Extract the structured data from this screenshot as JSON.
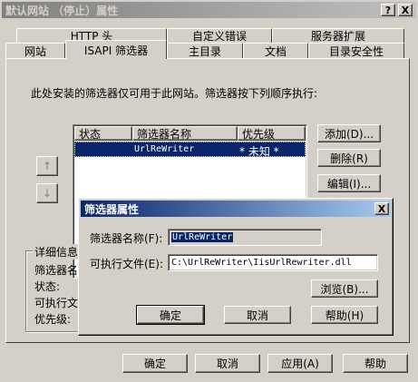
{
  "window": {
    "title": "默认网站 （停止）属性",
    "help_btn": "?",
    "close_btn": "X"
  },
  "tabs_row1": [
    "HTTP 头",
    "自定义错误",
    "服务器扩展"
  ],
  "tabs_row2": [
    "网站",
    "ISAPI 筛选器",
    "主目录",
    "文档",
    "目录安全性"
  ],
  "active_tab": "ISAPI 筛选器",
  "panel": {
    "description": "此处安装的筛选器仅可用于此网站。筛选器按下列顺序执行:",
    "columns": [
      "状态",
      "筛选器名称",
      "优先级"
    ],
    "rows": [
      {
        "status": "",
        "name": "UrlReWriter",
        "priority": "* 未知 *"
      }
    ],
    "buttons": {
      "add": "添加(D)...",
      "remove": "删除(R)",
      "edit": "编辑(I)..."
    },
    "move_up": "↑",
    "move_down": "↓",
    "details": {
      "title": "详细信息",
      "name_label": "筛选器名",
      "status_label": "状态:",
      "exe_label": "可执行文",
      "priority_label": "优先级:"
    }
  },
  "dialog": {
    "title": "筛选器属性",
    "close_btn": "X",
    "name_label": "筛选器名称(F):",
    "name_value": "UrlReWriter",
    "exe_label": "可执行文件(E):",
    "exe_value": "C:\\UrlReWriter\\IisUrlRewriter.dll",
    "browse": "浏览(B)...",
    "ok": "确定",
    "cancel": "取消",
    "help": "帮助(H)"
  },
  "footer": {
    "ok": "确定",
    "cancel": "取消",
    "apply": "应用(A)",
    "help": "帮助"
  }
}
